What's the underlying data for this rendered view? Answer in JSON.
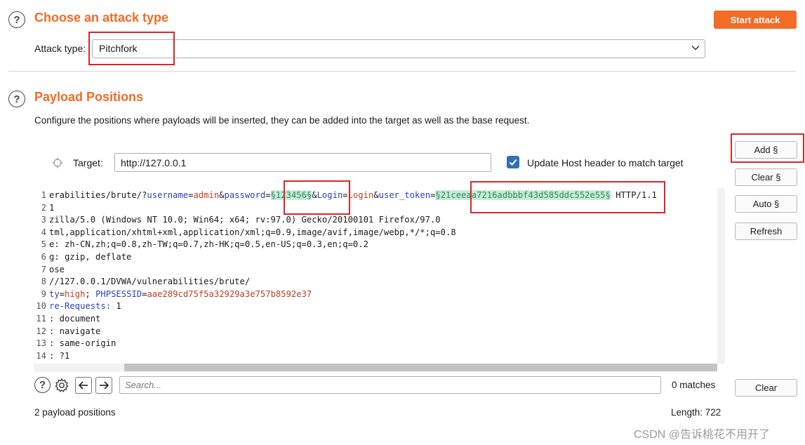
{
  "attack": {
    "title": "Choose an attack type",
    "start_label": "Start attack",
    "type_label": "Attack type:",
    "type_value": "Pitchfork"
  },
  "positions": {
    "title": "Payload Positions",
    "description": "Configure the positions where payloads will be inserted, they can be added into the target as well as the base request.",
    "target_label": "Target:",
    "target_value": "http://127.0.0.1",
    "update_host_label": "Update Host header to match target",
    "update_host_checked": true
  },
  "side_buttons": {
    "add": "Add §",
    "clear": "Clear §",
    "auto": "Auto §",
    "refresh": "Refresh",
    "clear_search": "Clear"
  },
  "request_lines": [
    {
      "num": "1",
      "parts": [
        {
          "t": "erabilities/brute/?",
          "c": "sym"
        },
        {
          "t": "username",
          "c": "key"
        },
        {
          "t": "=",
          "c": "sym"
        },
        {
          "t": "admin",
          "c": "val"
        },
        {
          "t": "&",
          "c": "sym"
        },
        {
          "t": "password",
          "c": "key"
        },
        {
          "t": "=",
          "c": "sym"
        },
        {
          "t": "§123456§",
          "c": "pay"
        },
        {
          "t": "&",
          "c": "sym"
        },
        {
          "t": "Login",
          "c": "key"
        },
        {
          "t": "=",
          "c": "sym"
        },
        {
          "t": "Login",
          "c": "val"
        },
        {
          "t": "&",
          "c": "sym"
        },
        {
          "t": "user_token",
          "c": "key"
        },
        {
          "t": "=",
          "c": "sym"
        },
        {
          "t": "§21ceeaa7216adbbbf43d585ddc552e55§",
          "c": "pay"
        },
        {
          "t": " HTTP/1.1",
          "c": "sym"
        }
      ]
    },
    {
      "num": "2",
      "parts": [
        {
          "t": "1",
          "c": "sym"
        }
      ]
    },
    {
      "num": "3",
      "parts": [
        {
          "t": "zilla/5.0 (Windows NT 10.0; Win64; x64; rv:97.0) Gecko/20100101 Firefox/97.0",
          "c": "sym"
        }
      ]
    },
    {
      "num": "4",
      "parts": [
        {
          "t": "tml,application/xhtml+xml,application/xml;q=0.9,image/avif,image/webp,*/*;q=0.8",
          "c": "sym"
        }
      ]
    },
    {
      "num": "5",
      "parts": [
        {
          "t": "e: zh-CN,zh;q=0.8,zh-TW;q=0.7,zh-HK;q=0.5,en-US;q=0.3,en;q=0.2",
          "c": "sym"
        }
      ]
    },
    {
      "num": "6",
      "parts": [
        {
          "t": "g: gzip, deflate",
          "c": "sym"
        }
      ]
    },
    {
      "num": "7",
      "parts": [
        {
          "t": "ose",
          "c": "sym"
        }
      ]
    },
    {
      "num": "8",
      "parts": [
        {
          "t": "//127.0.0.1/DVWA/vulnerabilities/brute/",
          "c": "sym"
        }
      ]
    },
    {
      "num": "9",
      "parts": [
        {
          "t": "ty",
          "c": "key"
        },
        {
          "t": "=",
          "c": "sym"
        },
        {
          "t": "high",
          "c": "val"
        },
        {
          "t": "; ",
          "c": "sym"
        },
        {
          "t": "PHPSESSID",
          "c": "key"
        },
        {
          "t": "=",
          "c": "sym"
        },
        {
          "t": "aae289cd75f5a32929a3e757b8592e37",
          "c": "val"
        }
      ]
    },
    {
      "num": "10",
      "parts": [
        {
          "t": "re-Requests:",
          "c": "key"
        },
        {
          "t": " 1",
          "c": "sym"
        }
      ]
    },
    {
      "num": "11",
      "parts": [
        {
          "t": ": document",
          "c": "sym"
        }
      ]
    },
    {
      "num": "12",
      "parts": [
        {
          "t": ": navigate",
          "c": "sym"
        }
      ]
    },
    {
      "num": "13",
      "parts": [
        {
          "t": ": same-origin",
          "c": "sym"
        }
      ]
    },
    {
      "num": "14",
      "parts": [
        {
          "t": ": ?1",
          "c": "sym"
        }
      ]
    }
  ],
  "search": {
    "placeholder": "Search...",
    "matches": "0 matches"
  },
  "footer": {
    "payload_positions": "2 payload positions",
    "length": "Length: 722",
    "watermark": "CSDN @告诉桃花不用开了"
  },
  "icons": {
    "help": "question-circle-icon",
    "crosshair": "crosshair-icon",
    "gear": "gear-icon",
    "arrow_left": "arrow-left-icon",
    "arrow_right": "arrow-right-icon",
    "dropdown": "chevron-down-icon",
    "checkbox": "checkbox-checked-icon"
  },
  "colors": {
    "accent": "#f26b27",
    "highlight_box": "#d9262b",
    "payload_bg": "#c6ead8",
    "checkbox": "#2f6fb5"
  }
}
